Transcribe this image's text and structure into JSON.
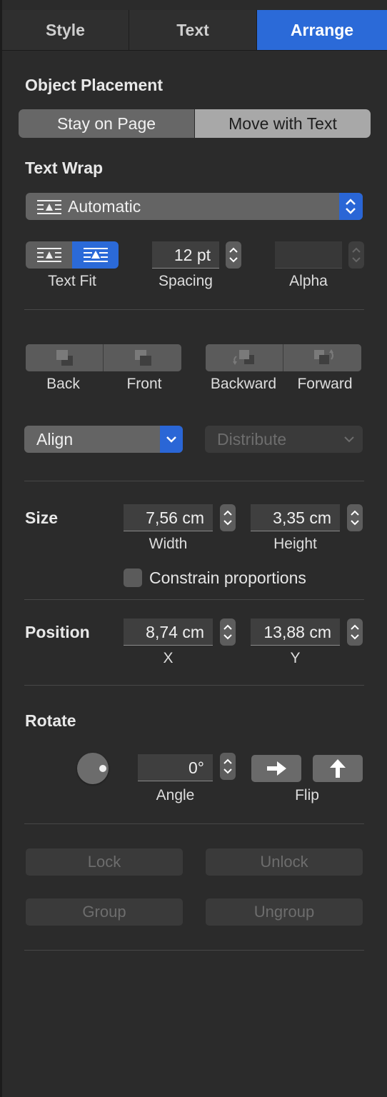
{
  "tabs": [
    "Style",
    "Text",
    "Arrange"
  ],
  "object_placement": {
    "heading": "Object Placement",
    "options": [
      "Stay on Page",
      "Move with Text"
    ],
    "selected": "Stay on Page"
  },
  "text_wrap": {
    "heading": "Text Wrap",
    "value": "Automatic",
    "text_fit_label": "Text Fit",
    "spacing_value": "12 pt",
    "spacing_label": "Spacing",
    "alpha_label": "Alpha",
    "alpha_value": ""
  },
  "layering": {
    "back": "Back",
    "front": "Front",
    "backward": "Backward",
    "forward": "Forward"
  },
  "align": {
    "label": "Align",
    "distribute": "Distribute"
  },
  "size": {
    "heading": "Size",
    "width_value": "7,56 cm",
    "width_label": "Width",
    "height_value": "3,35 cm",
    "height_label": "Height",
    "constrain_label": "Constrain proportions",
    "constrain_checked": false
  },
  "position": {
    "heading": "Position",
    "x_value": "8,74 cm",
    "x_label": "X",
    "y_value": "13,88 cm",
    "y_label": "Y"
  },
  "rotate": {
    "heading": "Rotate",
    "angle_value": "0°",
    "angle_label": "Angle",
    "flip_label": "Flip"
  },
  "actions": {
    "lock": "Lock",
    "unlock": "Unlock",
    "group": "Group",
    "ungroup": "Ungroup"
  },
  "colors": {
    "accent": "#2b6ad8",
    "background": "#2b2b2b"
  },
  "icons": {
    "wrap": "text-wrap-icon",
    "popup_chevron": "chevron-updown-icon",
    "stepper": "stepper-icon",
    "flip_horizontal": "arrow-right-icon",
    "flip_vertical": "arrow-up-icon"
  }
}
